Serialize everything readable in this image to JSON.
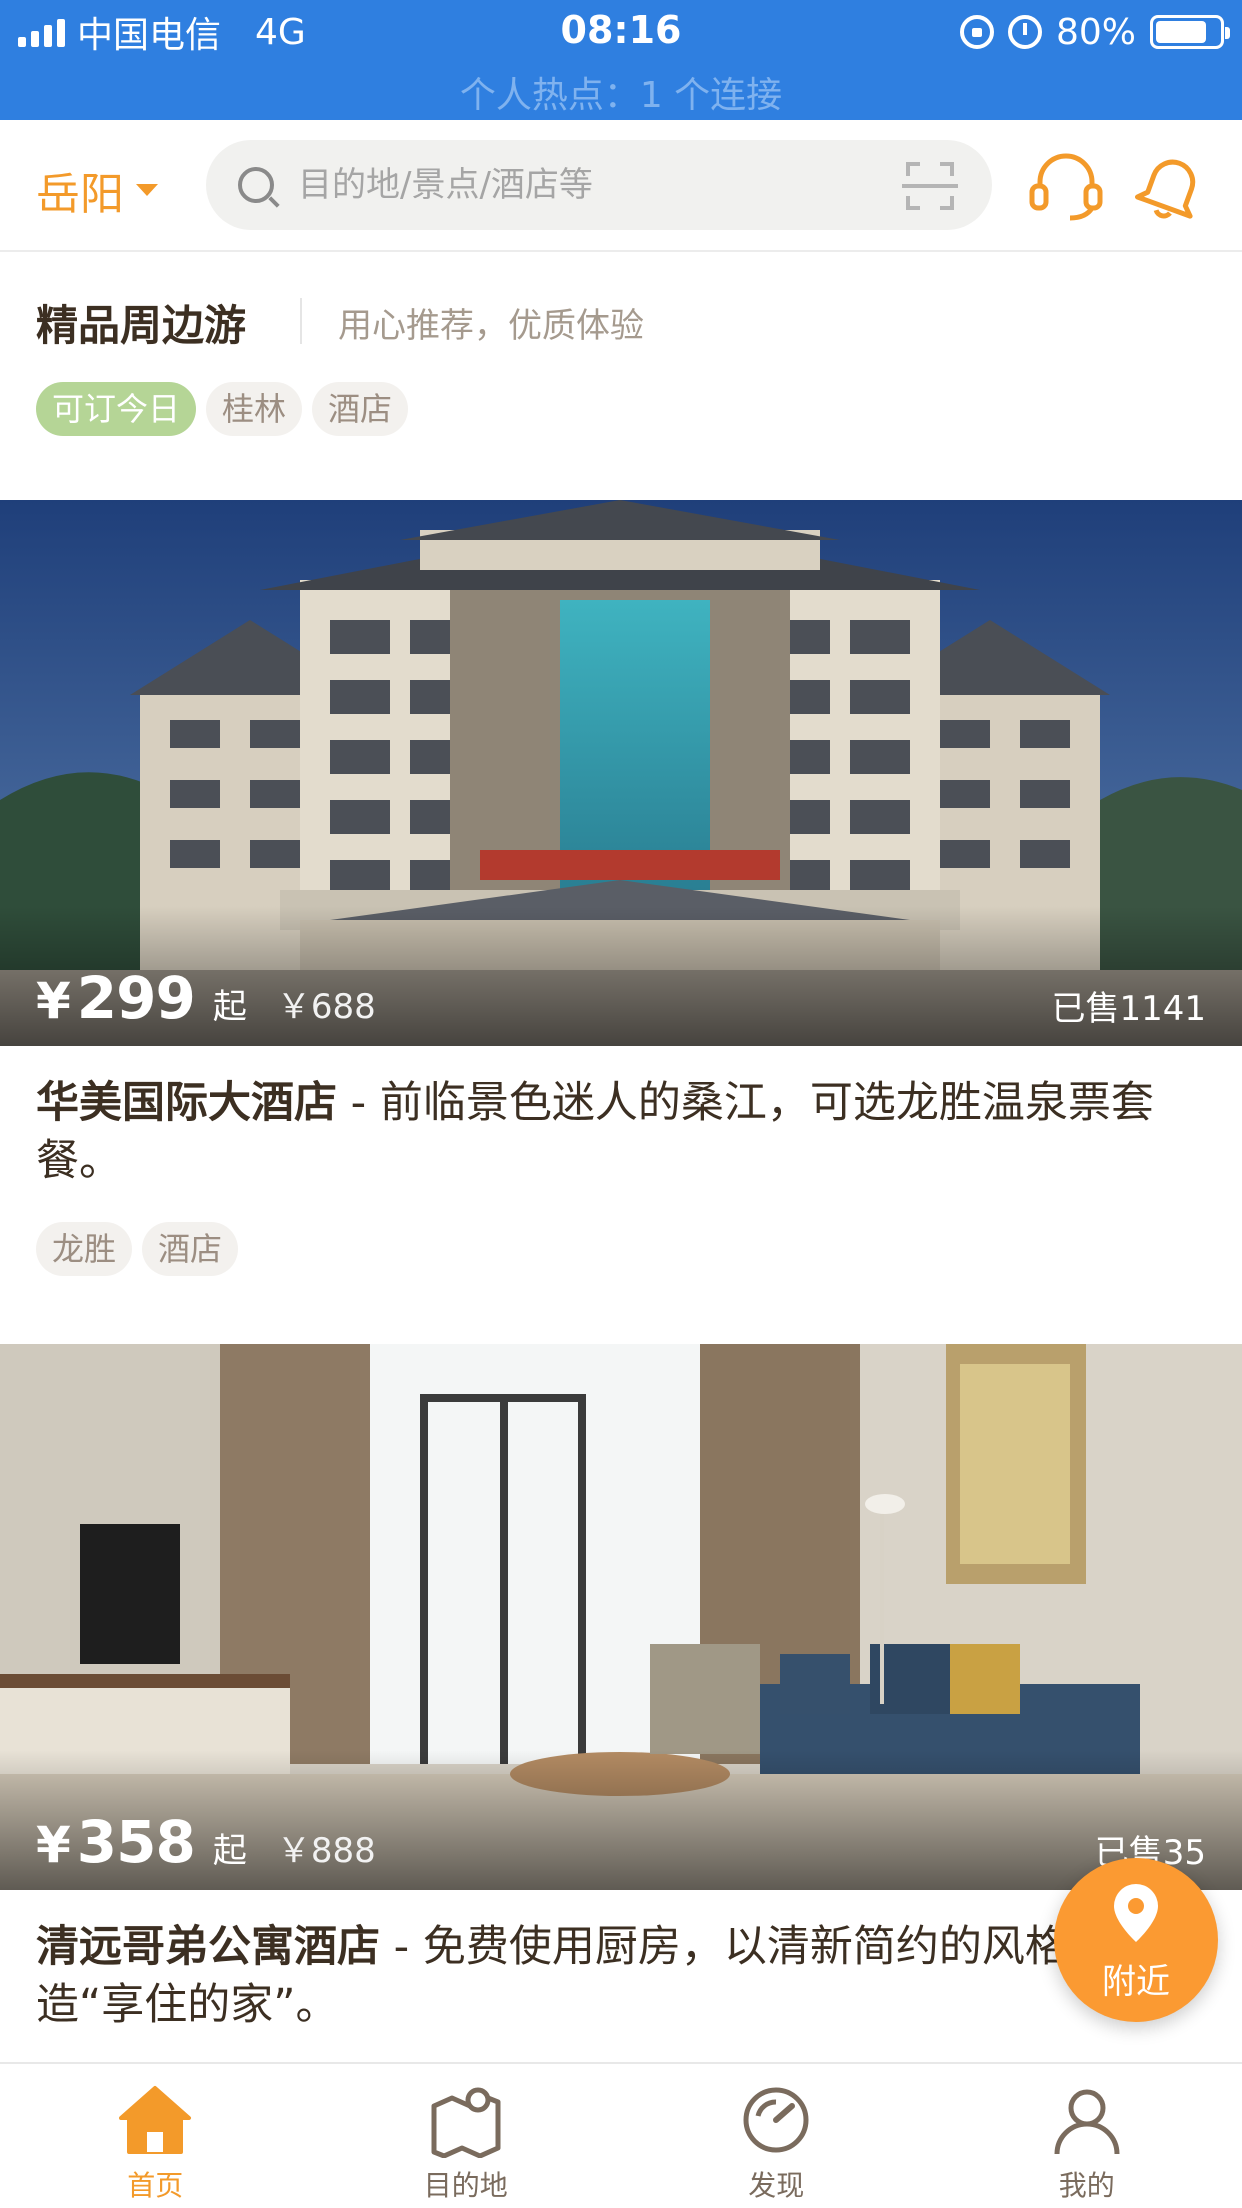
{
  "status_bar": {
    "carrier": "中国电信",
    "network": "4G",
    "time": "08:16",
    "battery": "80%",
    "battery_level": 0.8,
    "hotspot": "个人热点：1 个连接"
  },
  "header": {
    "city": "岳阳",
    "search_placeholder": "目的地/景点/酒店等",
    "icons": [
      "location-dropdown-icon",
      "search-icon",
      "scan-icon",
      "customer-service-icon",
      "bell-icon"
    ]
  },
  "section": {
    "title": "精品周边游",
    "subtitle": "用心推荐，优质体验",
    "filter_tags": [
      "可订今日",
      "桂林",
      "酒店"
    ]
  },
  "cards": [
    {
      "currency": "¥",
      "price": "299",
      "price_suffix": "起",
      "original_price": "￥688",
      "sold": "已售1141",
      "name": "华美国际大酒店",
      "description": " - 前临景色迷人的桑江，可选龙胜温泉票套餐。",
      "tags": [
        "龙胜",
        "酒店"
      ]
    },
    {
      "currency": "¥",
      "price": "358",
      "price_suffix": "起",
      "original_price": "￥888",
      "sold": "已售35",
      "name": "清远哥弟公寓酒店",
      "description": " - 免费使用厨房，以清新简约的风格，打造“享住的家”。"
    }
  ],
  "nearby_button": {
    "label": "附近",
    "icon": "location-pin-icon"
  },
  "tab_bar": {
    "tabs": [
      {
        "label": "首页",
        "icon": "home-icon",
        "active": true
      },
      {
        "label": "目的地",
        "icon": "map-icon",
        "active": false
      },
      {
        "label": "发现",
        "icon": "compass-icon",
        "active": false
      },
      {
        "label": "我的",
        "icon": "user-icon",
        "active": false
      }
    ]
  },
  "colors": {
    "status_bar": "#2f7fe0",
    "accent": "#f39a2a",
    "active_tag": "#b5d596",
    "nearby": "#fb9a32"
  }
}
